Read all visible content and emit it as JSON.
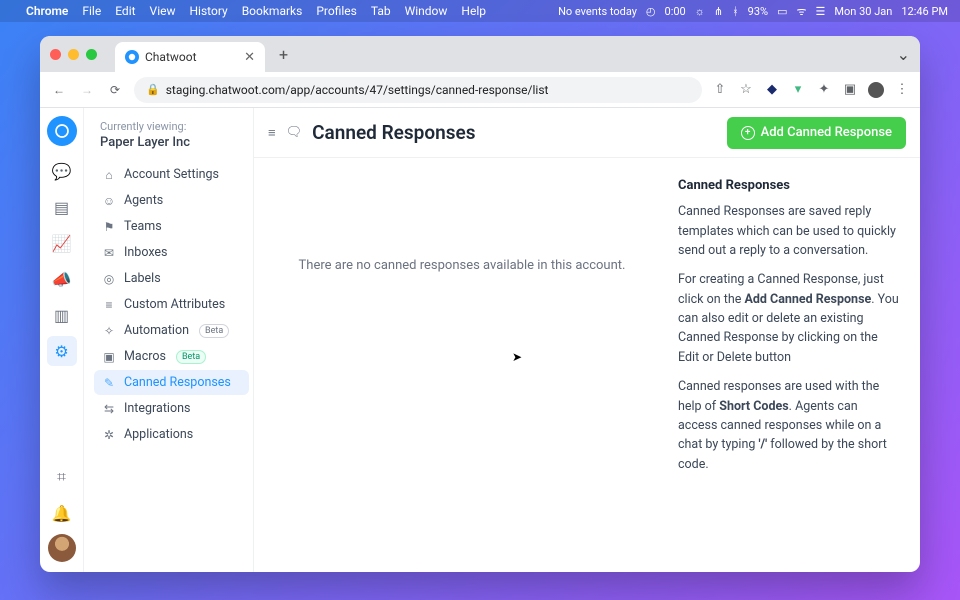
{
  "menubar": {
    "app": "Chrome",
    "items": [
      "File",
      "Edit",
      "View",
      "History",
      "Bookmarks",
      "Profiles",
      "Tab",
      "Window",
      "Help"
    ],
    "noevents": "No events today",
    "time1": "0:00",
    "battery": "93%",
    "date": "Mon 30 Jan",
    "clock": "12:46 PM"
  },
  "browser": {
    "tabtitle": "Chatwoot",
    "url": "staging.chatwoot.com/app/accounts/47/settings/canned-response/list"
  },
  "sidebar": {
    "viewing_label": "Currently viewing:",
    "account_name": "Paper Layer Inc",
    "items": [
      {
        "icon": "⌂",
        "label": "Account Settings"
      },
      {
        "icon": "☺",
        "label": "Agents"
      },
      {
        "icon": "⚑",
        "label": "Teams"
      },
      {
        "icon": "✉",
        "label": "Inboxes"
      },
      {
        "icon": "◎",
        "label": "Labels"
      },
      {
        "icon": "≡",
        "label": "Custom Attributes"
      },
      {
        "icon": "✧",
        "label": "Automation",
        "badge": "Beta",
        "badgeclass": "badge"
      },
      {
        "icon": "▣",
        "label": "Macros",
        "badge": "Beta",
        "badgeclass": "badge badgeg"
      },
      {
        "icon": "✎",
        "label": "Canned Responses",
        "active": true
      },
      {
        "icon": "⇆",
        "label": "Integrations"
      },
      {
        "icon": "✲",
        "label": "Applications"
      }
    ]
  },
  "page": {
    "title": "Canned Responses",
    "add_button": "Add Canned Response",
    "empty": "There are no canned responses available in this account.",
    "info_title": "Canned Responses",
    "info_p1": "Canned Responses are saved reply templates which can be used to quickly send out a reply to a conversation.",
    "info_p2a": "For creating a Canned Response, just click on the ",
    "info_p2b": "Add Canned Response",
    "info_p2c": ". You can also edit or delete an existing Canned Response by clicking on the Edit or Delete button",
    "info_p3a": "Canned responses are used with the help of ",
    "info_p3b": "Short Codes",
    "info_p3c": ". Agents can access canned responses while on a chat by typing ",
    "info_p3d": "'/'",
    "info_p3e": " followed by the short code."
  }
}
